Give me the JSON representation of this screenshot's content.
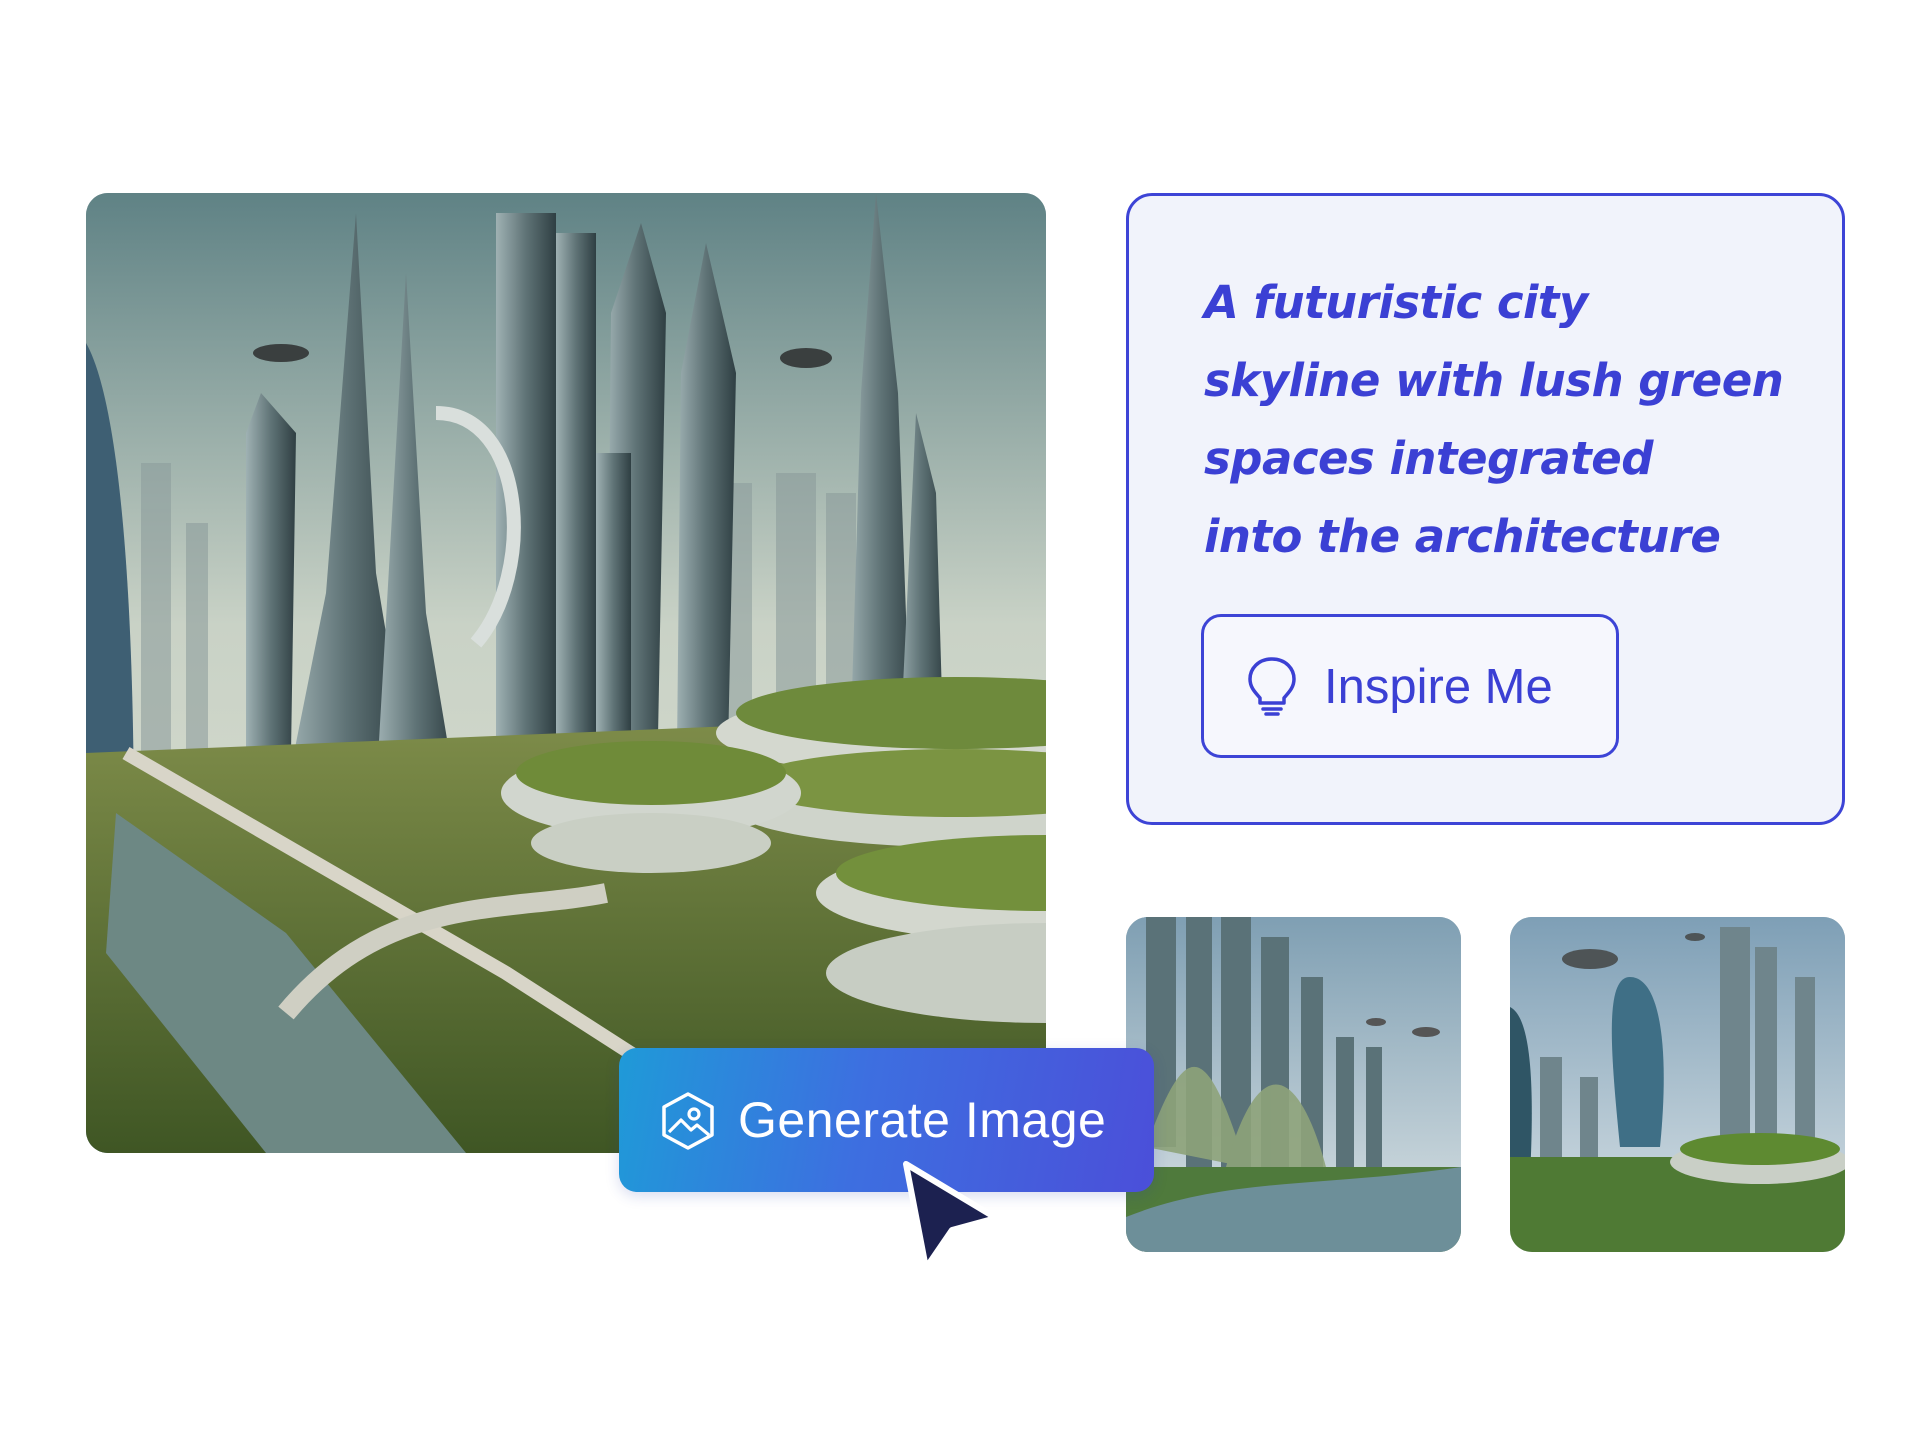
{
  "prompt": {
    "lines": [
      "A futuristic city",
      "skyline with lush green",
      "spaces integrated",
      "into the architecture"
    ]
  },
  "buttons": {
    "inspire_label": "Inspire Me",
    "generate_label": "Generate Image"
  },
  "icons": {
    "inspire": "lightbulb-icon",
    "generate": "image-gallery-icon",
    "cursor": "mouse-pointer-icon"
  },
  "colors": {
    "accent": "#3b40d4",
    "card_background": "#f1f3fb",
    "gradient_start": "#1f9ad8",
    "gradient_end": "#4b4fd9",
    "cursor_fill": "#1c2150"
  }
}
